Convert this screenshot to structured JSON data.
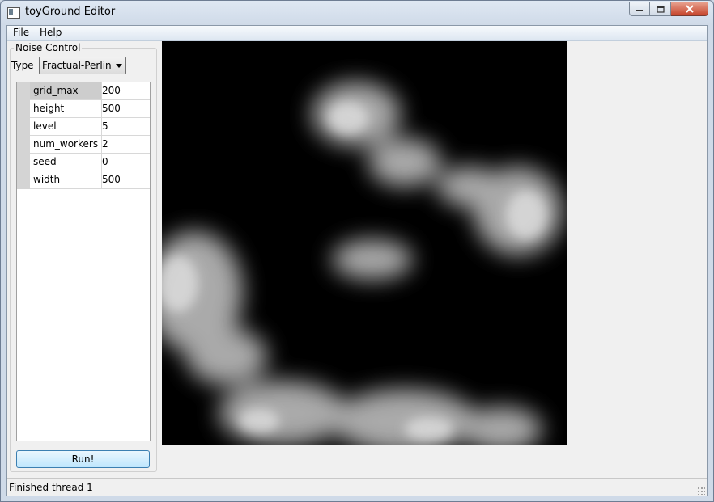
{
  "window": {
    "title": "toyGround Editor"
  },
  "menu": {
    "items": [
      "File",
      "Help"
    ]
  },
  "noise_control": {
    "title": "Noise Control",
    "type_label": "Type",
    "type_value": "Fractual-Perlin",
    "params": [
      {
        "key": "grid_max",
        "value": "200"
      },
      {
        "key": "height",
        "value": "500"
      },
      {
        "key": "level",
        "value": "5"
      },
      {
        "key": "num_workers",
        "value": "2"
      },
      {
        "key": "seed",
        "value": "0"
      },
      {
        "key": "width",
        "value": "500"
      }
    ],
    "run_label": "Run!"
  },
  "status": {
    "text": "Finished thread 1"
  },
  "colors": {
    "noise_bg": "#000000",
    "cloud": "#d8d8d8",
    "run_button_border": "#3c7fb1"
  }
}
